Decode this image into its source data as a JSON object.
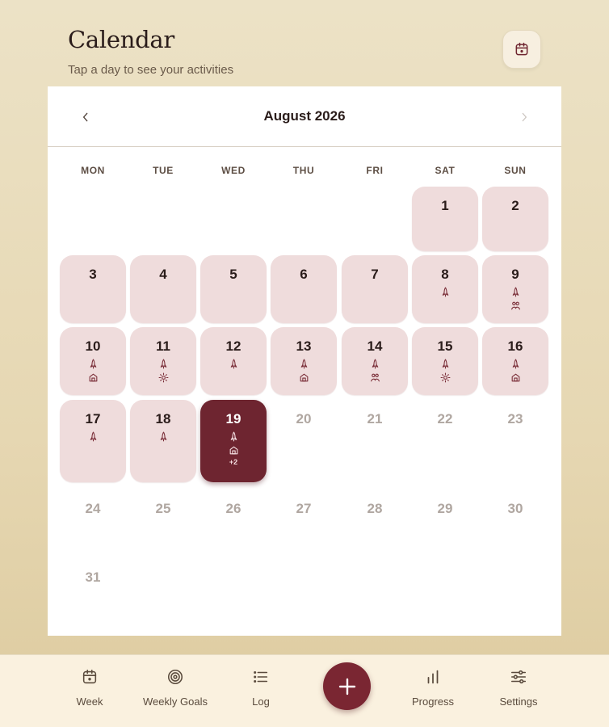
{
  "header": {
    "title": "Calendar",
    "subtitle": "Tap a day to see your activities",
    "calendar_button_icon": "calendar-icon"
  },
  "calendar": {
    "month_label": "August 2026",
    "weekdays": [
      "MON",
      "TUE",
      "WED",
      "THU",
      "FRI",
      "SAT",
      "SUN"
    ],
    "days": [
      {
        "n": "1",
        "state": "active",
        "icons": []
      },
      {
        "n": "2",
        "state": "active",
        "icons": []
      },
      {
        "n": "3",
        "state": "active",
        "icons": []
      },
      {
        "n": "4",
        "state": "active",
        "icons": []
      },
      {
        "n": "5",
        "state": "active",
        "icons": []
      },
      {
        "n": "6",
        "state": "active",
        "icons": []
      },
      {
        "n": "7",
        "state": "active",
        "icons": []
      },
      {
        "n": "8",
        "state": "active",
        "icons": [
          "rocket"
        ]
      },
      {
        "n": "9",
        "state": "active",
        "icons": [
          "rocket",
          "people"
        ]
      },
      {
        "n": "10",
        "state": "active",
        "icons": [
          "rocket",
          "home"
        ]
      },
      {
        "n": "11",
        "state": "active",
        "icons": [
          "rocket",
          "sun"
        ]
      },
      {
        "n": "12",
        "state": "active",
        "icons": [
          "rocket"
        ]
      },
      {
        "n": "13",
        "state": "active",
        "icons": [
          "rocket",
          "home"
        ]
      },
      {
        "n": "14",
        "state": "active",
        "icons": [
          "rocket",
          "people"
        ]
      },
      {
        "n": "15",
        "state": "active",
        "icons": [
          "rocket",
          "sun"
        ]
      },
      {
        "n": "16",
        "state": "active",
        "icons": [
          "rocket",
          "home"
        ]
      },
      {
        "n": "17",
        "state": "active",
        "icons": [
          "rocket"
        ]
      },
      {
        "n": "18",
        "state": "active",
        "icons": [
          "rocket"
        ]
      },
      {
        "n": "19",
        "state": "selected",
        "icons": [
          "rocket",
          "home"
        ],
        "more": "+2"
      },
      {
        "n": "20",
        "state": "future",
        "icons": []
      },
      {
        "n": "21",
        "state": "future",
        "icons": []
      },
      {
        "n": "22",
        "state": "future",
        "icons": []
      },
      {
        "n": "23",
        "state": "future",
        "icons": []
      },
      {
        "n": "24",
        "state": "future",
        "icons": []
      },
      {
        "n": "25",
        "state": "future",
        "icons": []
      },
      {
        "n": "26",
        "state": "future",
        "icons": []
      },
      {
        "n": "27",
        "state": "future",
        "icons": []
      },
      {
        "n": "28",
        "state": "future",
        "icons": []
      },
      {
        "n": "29",
        "state": "future",
        "icons": []
      },
      {
        "n": "30",
        "state": "future",
        "icons": []
      },
      {
        "n": "31",
        "state": "future",
        "icons": []
      }
    ]
  },
  "tabs": [
    {
      "label": "Week",
      "icon": "calendar-icon"
    },
    {
      "label": "Weekly Goals",
      "icon": "target-icon"
    },
    {
      "label": "Log",
      "icon": "list-icon"
    },
    {
      "label": "Progress",
      "icon": "bar-chart-icon"
    },
    {
      "label": "Settings",
      "icon": "sliders-icon"
    }
  ],
  "fab_icon": "plus-icon",
  "colors": {
    "accent": "#7a2632",
    "active_day": "#efdcdc",
    "selected_day": "#6e2530"
  }
}
